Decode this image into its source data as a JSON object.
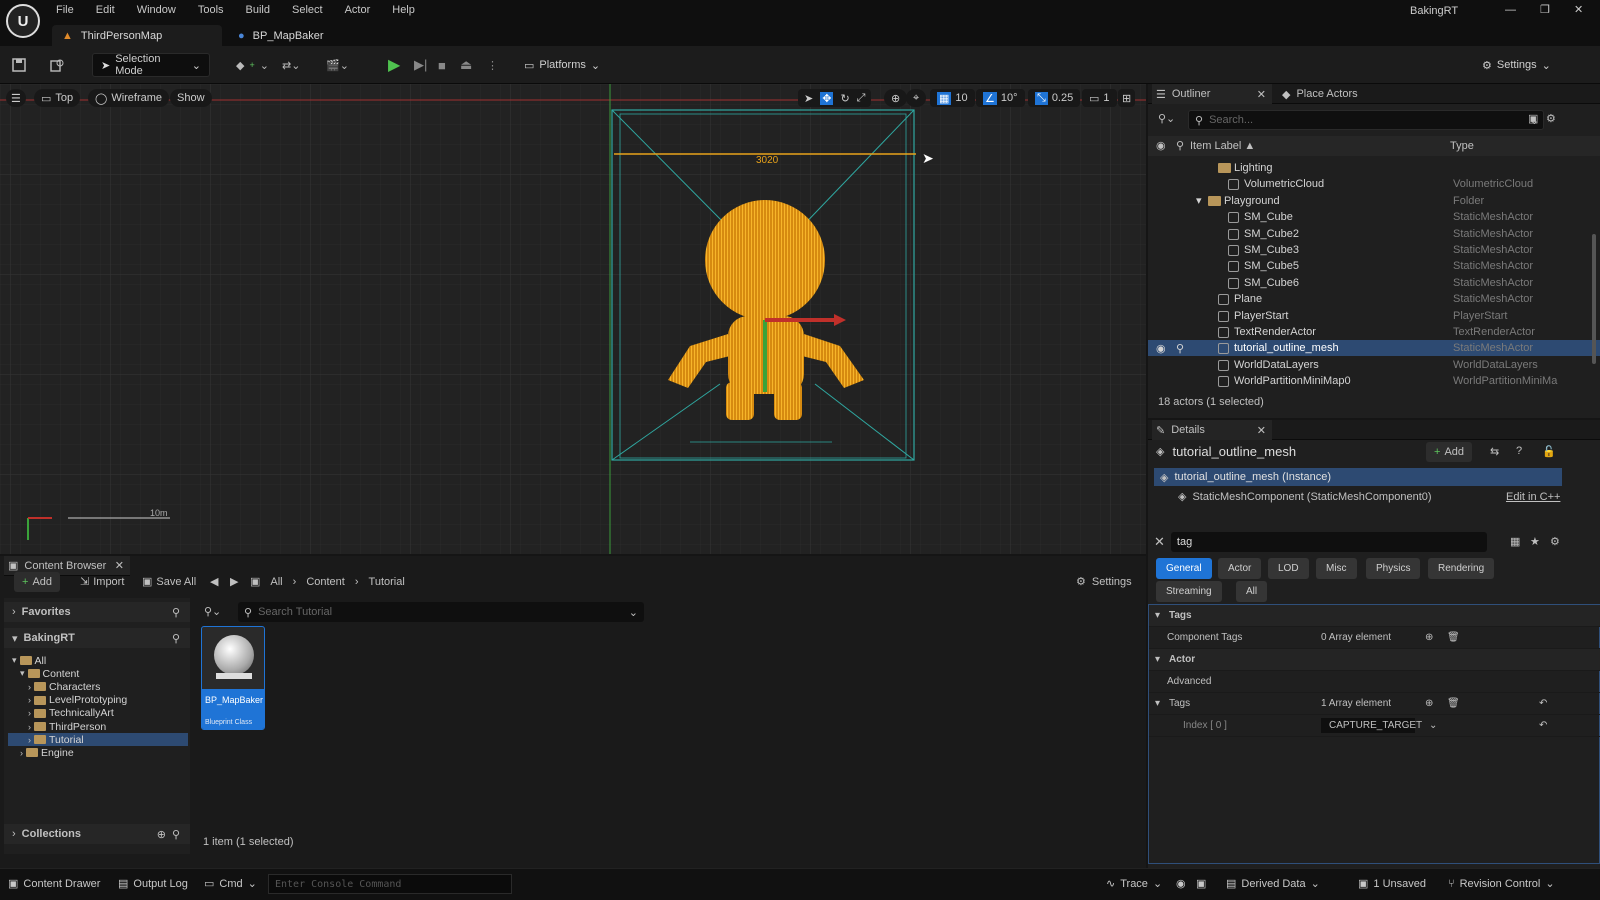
{
  "app": {
    "project": "BakingRT",
    "menus": [
      "File",
      "Edit",
      "Window",
      "Tools",
      "Build",
      "Select",
      "Actor",
      "Help"
    ],
    "tabs": [
      {
        "label": "ThirdPersonMap"
      },
      {
        "label": "BP_MapBaker"
      }
    ]
  },
  "toolbar": {
    "selection_mode": "Selection Mode",
    "platforms": "Platforms",
    "settings": "Settings"
  },
  "viewport": {
    "view": "Top",
    "shading": "Wireframe",
    "show": "Show",
    "grid_snap": "10",
    "rot_snap": "10°",
    "scale_snap": "0.25",
    "camera_speed": "1",
    "measure": "3020",
    "scale_label": "10m"
  },
  "outliner": {
    "tab": "Outliner",
    "place_actors": "Place Actors",
    "search_placeholder": "Search...",
    "col_label": "Item Label ▲",
    "col_type": "Type",
    "rows": [
      {
        "label": "Lighting",
        "type": "",
        "kind": "folder"
      },
      {
        "label": "VolumetricCloud",
        "type": "VolumetricCloud",
        "kind": "actor"
      },
      {
        "label": "Playground",
        "type": "Folder",
        "kind": "folder"
      },
      {
        "label": "SM_Cube",
        "type": "StaticMeshActor",
        "kind": "mesh"
      },
      {
        "label": "SM_Cube2",
        "type": "StaticMeshActor",
        "kind": "mesh"
      },
      {
        "label": "SM_Cube3",
        "type": "StaticMeshActor",
        "kind": "mesh"
      },
      {
        "label": "SM_Cube5",
        "type": "StaticMeshActor",
        "kind": "mesh"
      },
      {
        "label": "SM_Cube6",
        "type": "StaticMeshActor",
        "kind": "mesh"
      },
      {
        "label": "Plane",
        "type": "StaticMeshActor",
        "kind": "mesh"
      },
      {
        "label": "PlayerStart",
        "type": "PlayerStart",
        "kind": "actor"
      },
      {
        "label": "TextRenderActor",
        "type": "TextRenderActor",
        "kind": "actor"
      },
      {
        "label": "tutorial_outline_mesh",
        "type": "StaticMeshActor",
        "kind": "mesh",
        "selected": true
      },
      {
        "label": "WorldDataLayers",
        "type": "WorldDataLayers",
        "kind": "actor"
      },
      {
        "label": "WorldPartitionMiniMap0",
        "type": "WorldPartitionMiniMa",
        "kind": "actor"
      }
    ],
    "status": "18 actors (1 selected)"
  },
  "details": {
    "tab": "Details",
    "object": "tutorial_outline_mesh",
    "add": "Add",
    "instance": "tutorial_outline_mesh (Instance)",
    "component": "StaticMeshComponent (StaticMeshComponent0)",
    "edit_cpp": "Edit in C++",
    "search_value": "tag",
    "categories": [
      "General",
      "Actor",
      "LOD",
      "Misc",
      "Physics",
      "Rendering",
      "Streaming",
      "All"
    ],
    "sec_tags": "Tags",
    "component_tags": "Component Tags",
    "component_tags_val": "0 Array element",
    "sec_actor": "Actor",
    "advanced": "Advanced",
    "tags": "Tags",
    "tags_val": "1 Array element",
    "index": "Index [ 0 ]",
    "index_val": "CAPTURE_TARGET"
  },
  "content_browser": {
    "tab": "Content Browser",
    "add": "Add",
    "import": "Import",
    "save_all": "Save All",
    "crumbs": [
      "All",
      "Content",
      "Tutorial"
    ],
    "settings": "Settings",
    "favorites": "Favorites",
    "project": "BakingRT",
    "search_placeholder": "Search Tutorial",
    "tree": [
      {
        "label": "All",
        "level": 0
      },
      {
        "label": "Content",
        "level": 1
      },
      {
        "label": "Characters",
        "level": 2
      },
      {
        "label": "LevelPrototyping",
        "level": 2
      },
      {
        "label": "TechnicallyArt",
        "level": 2
      },
      {
        "label": "ThirdPerson",
        "level": 2
      },
      {
        "label": "Tutorial",
        "level": 2,
        "selected": true
      },
      {
        "label": "Engine",
        "level": 1
      }
    ],
    "asset_name": "BP_MapBaker",
    "asset_type": "Blueprint Class",
    "collections": "Collections",
    "count": "1 item (1 selected)"
  },
  "status": {
    "content_drawer": "Content Drawer",
    "output_log": "Output Log",
    "cmd": "Cmd",
    "console_placeholder": "Enter Console Command",
    "trace": "Trace",
    "derived_data": "Derived Data",
    "unsaved": "1 Unsaved",
    "revision": "Revision Control"
  },
  "colors": {
    "accent": "#1f74d6",
    "selection": "#2d4a72",
    "wire": "#e8a21a",
    "bounds": "#2fa7a0"
  }
}
